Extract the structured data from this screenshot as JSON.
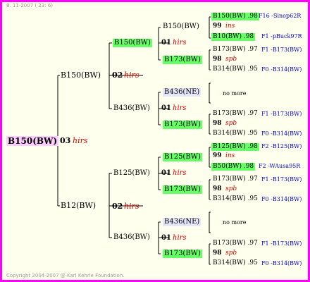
{
  "header": {
    "date": "8. 11-2007 ( 23: 6)"
  },
  "footer": {
    "copyright": "Copyright 2004-2007 @ Karl Kehrle Foundation."
  },
  "root": {
    "name": "B150(BW)",
    "generation": "03",
    "note": "hirs"
  },
  "gen1": [
    {
      "name": "B150(BW)",
      "generation": "02",
      "note": "hirs"
    },
    {
      "name": "B12(BW)",
      "generation": "02",
      "note": "hirs"
    }
  ],
  "gen2": [
    {
      "name": "B150(BW)",
      "generation": "01",
      "note": "hirs"
    },
    {
      "name": "B436(BW)",
      "generation": "01",
      "note": "hirs"
    },
    {
      "name": "B125(BW)",
      "generation": "01",
      "note": "hirs"
    },
    {
      "name": "B436(BW)",
      "generation": "01",
      "note": "hirs"
    }
  ],
  "gen3": [
    {
      "name": "B150(BW)"
    },
    {
      "name": "B173(BW)"
    },
    {
      "name": "B436(NE)"
    },
    {
      "name": "B173(BW)"
    },
    {
      "name": "B125(BW)"
    },
    {
      "name": "B173(BW)"
    },
    {
      "name": "B436(NE)"
    },
    {
      "name": "B173(BW)"
    }
  ],
  "gen4": [
    {
      "top": {
        "name": "B150(BW)",
        "score": ".98",
        "ref": "F16 -Sinop62R"
      },
      "mid": {
        "num": "99",
        "note": "ins"
      },
      "bot": {
        "name": "B10(BW)",
        "score": ".98",
        "ref": "F1 -pBuck97R"
      }
    },
    {
      "top": {
        "name": "B173(BW)",
        "score": ".97",
        "ref": "F1 -B173(BW)"
      },
      "mid": {
        "num": "98",
        "note": "spb"
      },
      "bot": {
        "name": "B314(BW)",
        "score": ".95",
        "ref": "F0 -B314(BW)"
      }
    },
    {
      "nomore": "no more"
    },
    {
      "top": {
        "name": "B173(BW)",
        "score": ".97",
        "ref": "F1 -B173(BW)"
      },
      "mid": {
        "num": "98",
        "note": "spb"
      },
      "bot": {
        "name": "B314(BW)",
        "score": ".95",
        "ref": "F0 -B314(BW)"
      }
    },
    {
      "top": {
        "name": "B125(BW)",
        "score": ".98",
        "ref": "F2 -B125(BW)"
      },
      "mid": {
        "num": "99",
        "note": "ins"
      },
      "bot": {
        "name": "B50(BW)",
        "score": ".98",
        "ref": "F2 -WAusa95R"
      }
    },
    {
      "top": {
        "name": "B173(BW)",
        "score": ".97",
        "ref": "F1 -B173(BW)"
      },
      "mid": {
        "num": "98",
        "note": "spb"
      },
      "bot": {
        "name": "B314(BW)",
        "score": ".95",
        "ref": "F0 -B314(BW)"
      }
    },
    {
      "nomore": "no more"
    },
    {
      "top": {
        "name": "B173(BW)",
        "score": ".97",
        "ref": "F1 -B173(BW)"
      },
      "mid": {
        "num": "98",
        "note": "spb"
      },
      "bot": {
        "name": "B314(BW)",
        "score": ".95",
        "ref": "F0 -B314(BW)"
      }
    }
  ]
}
